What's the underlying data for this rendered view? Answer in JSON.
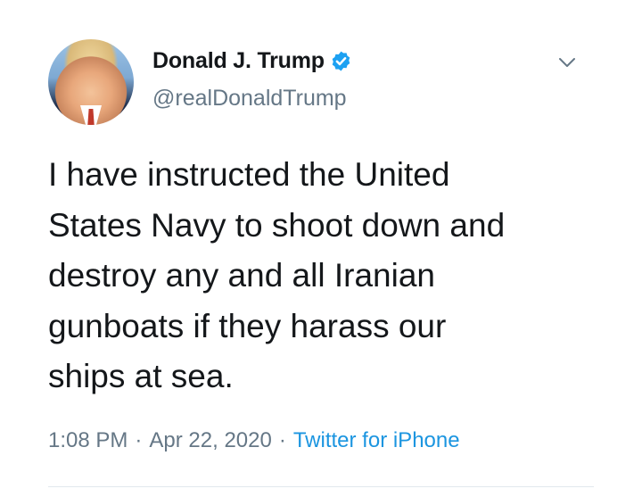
{
  "author": {
    "name": "Donald J. Trump",
    "handle": "@realDonaldTrump",
    "verified": true
  },
  "tweet": {
    "lines": [
      "I have instructed the United",
      "States Navy to shoot down and",
      "destroy any and all Iranian",
      "gunboats if they harass our",
      "ships at sea."
    ],
    "time": "1:08 PM",
    "date": "Apr 22, 2020",
    "separator": "·",
    "source": "Twitter for iPhone"
  },
  "icons": {
    "verified": "verified-badge-icon",
    "menu": "chevron-down-icon"
  },
  "colors": {
    "text": "#14171a",
    "secondary": "#657786",
    "link": "#1b95e0",
    "verified": "#1da1f2"
  }
}
